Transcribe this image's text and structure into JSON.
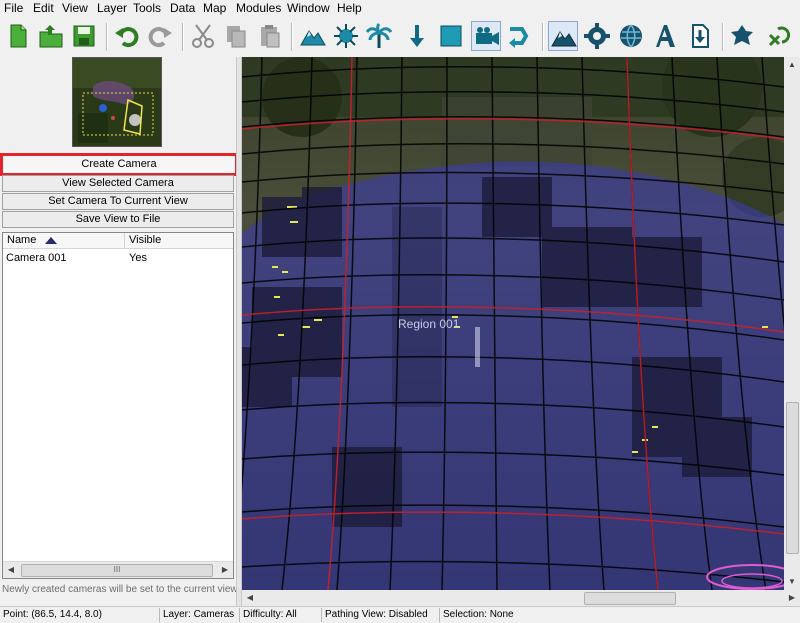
{
  "menu": [
    "File",
    "Edit",
    "View",
    "Layer",
    "Tools",
    "Data",
    "Map",
    "Modules",
    "Window",
    "Help"
  ],
  "toolbar": {
    "buttons": [
      {
        "name": "new-map",
        "icon": "new-document-icon"
      },
      {
        "name": "open-map",
        "icon": "open-folder-icon"
      },
      {
        "name": "save-map",
        "icon": "save-disk-icon"
      },
      {
        "name": "undo",
        "icon": "undo-icon"
      },
      {
        "name": "redo",
        "icon": "redo-icon"
      },
      {
        "name": "cut",
        "icon": "scissors-icon"
      },
      {
        "name": "copy",
        "icon": "copy-icon"
      },
      {
        "name": "paste",
        "icon": "paste-icon"
      },
      {
        "name": "terrain-layer",
        "icon": "terrain-icon"
      },
      {
        "name": "doodads-layer",
        "icon": "doodad-icon"
      },
      {
        "name": "tree-layer",
        "icon": "palm-tree-icon"
      },
      {
        "name": "units-layer",
        "icon": "arrow-down-icon"
      },
      {
        "name": "regions-layer",
        "icon": "region-square-icon"
      },
      {
        "name": "cameras-layer",
        "icon": "camera-icon"
      },
      {
        "name": "pathing-layer",
        "icon": "path-arrow-icon"
      },
      {
        "name": "terrain-editor",
        "icon": "terrain-editor-icon"
      },
      {
        "name": "trigger-editor",
        "icon": "trigger-gear-icon"
      },
      {
        "name": "data-editor",
        "icon": "data-globe-icon"
      },
      {
        "name": "text-editor",
        "icon": "text-a-icon"
      },
      {
        "name": "import-manager",
        "icon": "import-icon"
      },
      {
        "name": "ai-editor",
        "icon": "ai-icon"
      },
      {
        "name": "test-document",
        "icon": "test-run-icon"
      }
    ]
  },
  "camera_panel": {
    "buttons": {
      "create": "Create Camera",
      "view_selected": "View Selected Camera",
      "set_to_view": "Set Camera To Current View",
      "save_view": "Save View to File"
    },
    "list": {
      "columns": [
        "Name",
        "Visible"
      ],
      "rows": [
        {
          "name": "Camera 001",
          "visible": "Yes"
        }
      ],
      "scroll_thumb": "III"
    },
    "hint": "Newly created cameras will be set to the current view."
  },
  "viewport": {
    "region_label": "Region 001",
    "region_fill": "#3a3ab8"
  },
  "status": {
    "point": "Point: (86.5, 14.4, 8.0)",
    "layer": "Layer: Cameras",
    "difficulty": "Difficulty: All",
    "pathing": "Pathing View: Disabled",
    "selection": "Selection: None"
  },
  "colors": {
    "highlight": "#e0262b",
    "grid_black": "#000000",
    "grid_red": "#c8202a"
  }
}
